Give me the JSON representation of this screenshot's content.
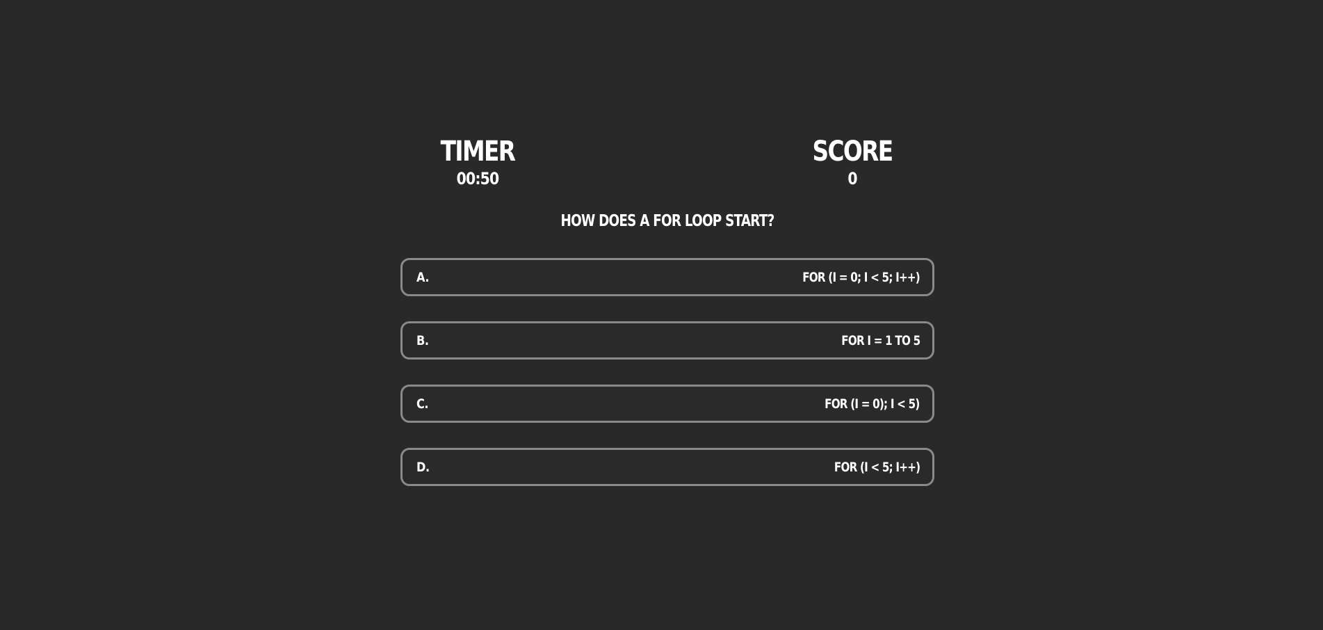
{
  "timer": {
    "label": "Timer",
    "value": "00:50"
  },
  "score": {
    "label": "Score",
    "value": "0"
  },
  "question": {
    "text": "How does a for loop start?"
  },
  "answers": [
    {
      "letter": "A.",
      "text": "for (i = 0; i < 5; i++)"
    },
    {
      "letter": "B.",
      "text": "for i = 1 to 5"
    },
    {
      "letter": "C.",
      "text": "for (i = 0); i < 5)"
    },
    {
      "letter": "D.",
      "text": "for (i < 5; i++)"
    }
  ],
  "colors": {
    "background": "#292929",
    "text": "#ffffff",
    "answer_border": "#8a8a8a"
  }
}
